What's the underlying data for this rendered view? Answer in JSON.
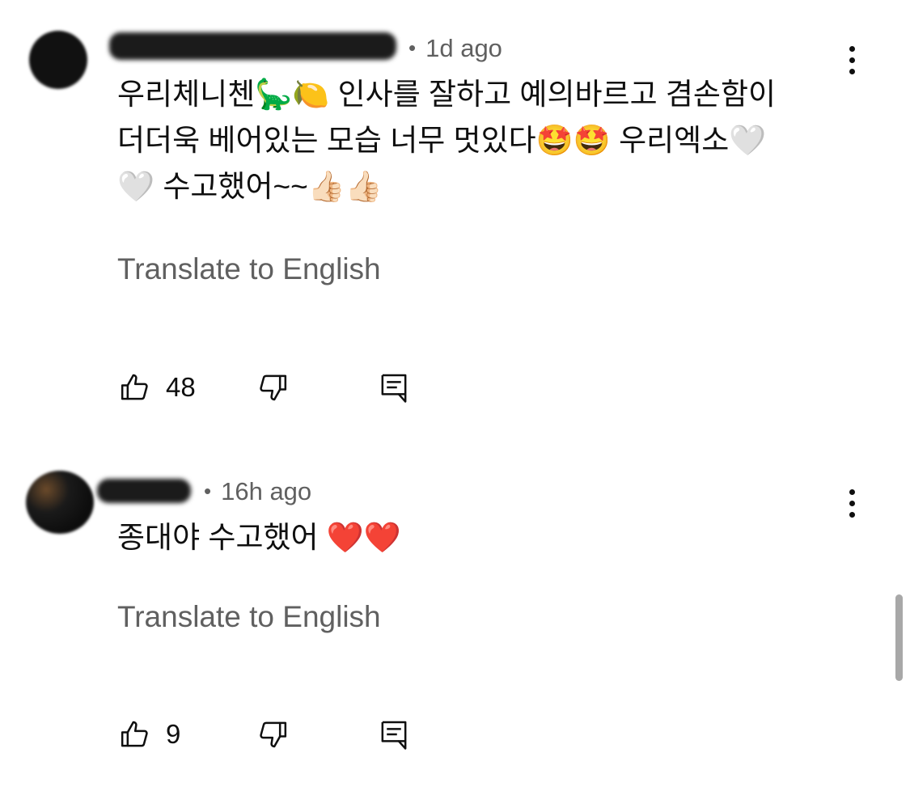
{
  "comments": [
    {
      "time": "1d ago",
      "text": "우리체니첸🦕🍋 인사를 잘하고 예의바르고 겸손함이\n더더욱 베어있는 모습 너무 멋있다🤩🤩 우리엑소🤍\n🤍 수고했어~~👍🏻👍🏻",
      "translate_label": "Translate to English",
      "likes": "48"
    },
    {
      "time": "16h ago",
      "text": "종대야 수고했어 ❤️❤️",
      "translate_label": "Translate to English",
      "likes": "9"
    }
  ],
  "icons": {
    "like": "thumbs-up-icon",
    "dislike": "thumbs-down-icon",
    "reply": "reply-comment-icon",
    "more": "more-vertical-icon"
  },
  "colors": {
    "text": "#0f0f0f",
    "secondary": "#606060",
    "background": "#ffffff",
    "scrollbar": "#a8a8a8"
  }
}
